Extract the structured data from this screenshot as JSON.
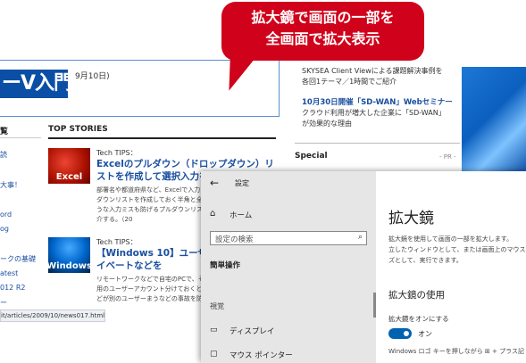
{
  "callout": {
    "line1": "拡大鏡で画面の一部を",
    "line2": "全画面で拡大表示"
  },
  "web": {
    "banner_logo": "ーV入門",
    "banner_date": "9月10日)",
    "side_nav": {
      "header": "覧",
      "items": [
        "読",
        "大事！",
        "ord",
        "og",
        "ークの基礎",
        "atest",
        "012 R2",
        "ー"
      ]
    },
    "top_stories": "TOP STORIES",
    "stories": [
      {
        "tag": "Tech TIPS：",
        "title": "Excelのプルダウン（ドロップダウン）リストを作成して選択入力を利用する",
        "desc": "部署名や都道府県など、Excelで入力するような場合、プルダウンリストを作成しておく半角と全角が混じってしまうような入力ミスも防げるプルダウンリストを作成する方法を紹介する。（20",
        "thumb": "Excel"
      },
      {
        "tag": "Tech TIPS：",
        "title": "【Windows 10】ユーザーで仕事とプライベートなどを",
        "desc": "リモートワークなどで自宅のPCで、そのような場合、仕事用のユーザーアカウント分けておくと、作成したファイルなどが別のユーザーまうなどの事故を防ぐことができる。",
        "thumb": "Windows"
      }
    ],
    "status_url": "it/articles/2009/10/news017.html",
    "right_col": {
      "line1": "SKYSEA Client Viewによる課題解決事例を",
      "line2": "各回1テーマ／1時間でご紹介",
      "link": "10月30日開催「SD-WAN」Webセミナー",
      "line3": "クラウド利用が増大した企業に「SD-WAN」",
      "line4": "が効果的な理由",
      "special": "Special",
      "pr": "- PR -"
    }
  },
  "settings": {
    "title": "設定",
    "back_glyph": "←",
    "home": "ホーム",
    "search_placeholder": "設定の検索",
    "section": "簡単操作",
    "group": "視覚",
    "items": [
      "ディスプレイ",
      "マウス ポインター"
    ],
    "content": {
      "title": "拡大鏡",
      "desc1": "拡大鏡を使用して画面の一部を拡大します。",
      "desc2": "立したウィンドウとして、または画面上のマウス",
      "desc3": "ズとして、実行できます。",
      "section": "拡大鏡の使用",
      "toggle_label": "拡大鏡をオンにする",
      "toggle_state": "オン",
      "toggle_on": true,
      "hint": "Windows ロゴ キーを押しながら ⊞ + プラス記"
    }
  },
  "colors": {
    "callout": "#d0021b",
    "accent": "#0063b1",
    "link": "#1a4fa0"
  }
}
